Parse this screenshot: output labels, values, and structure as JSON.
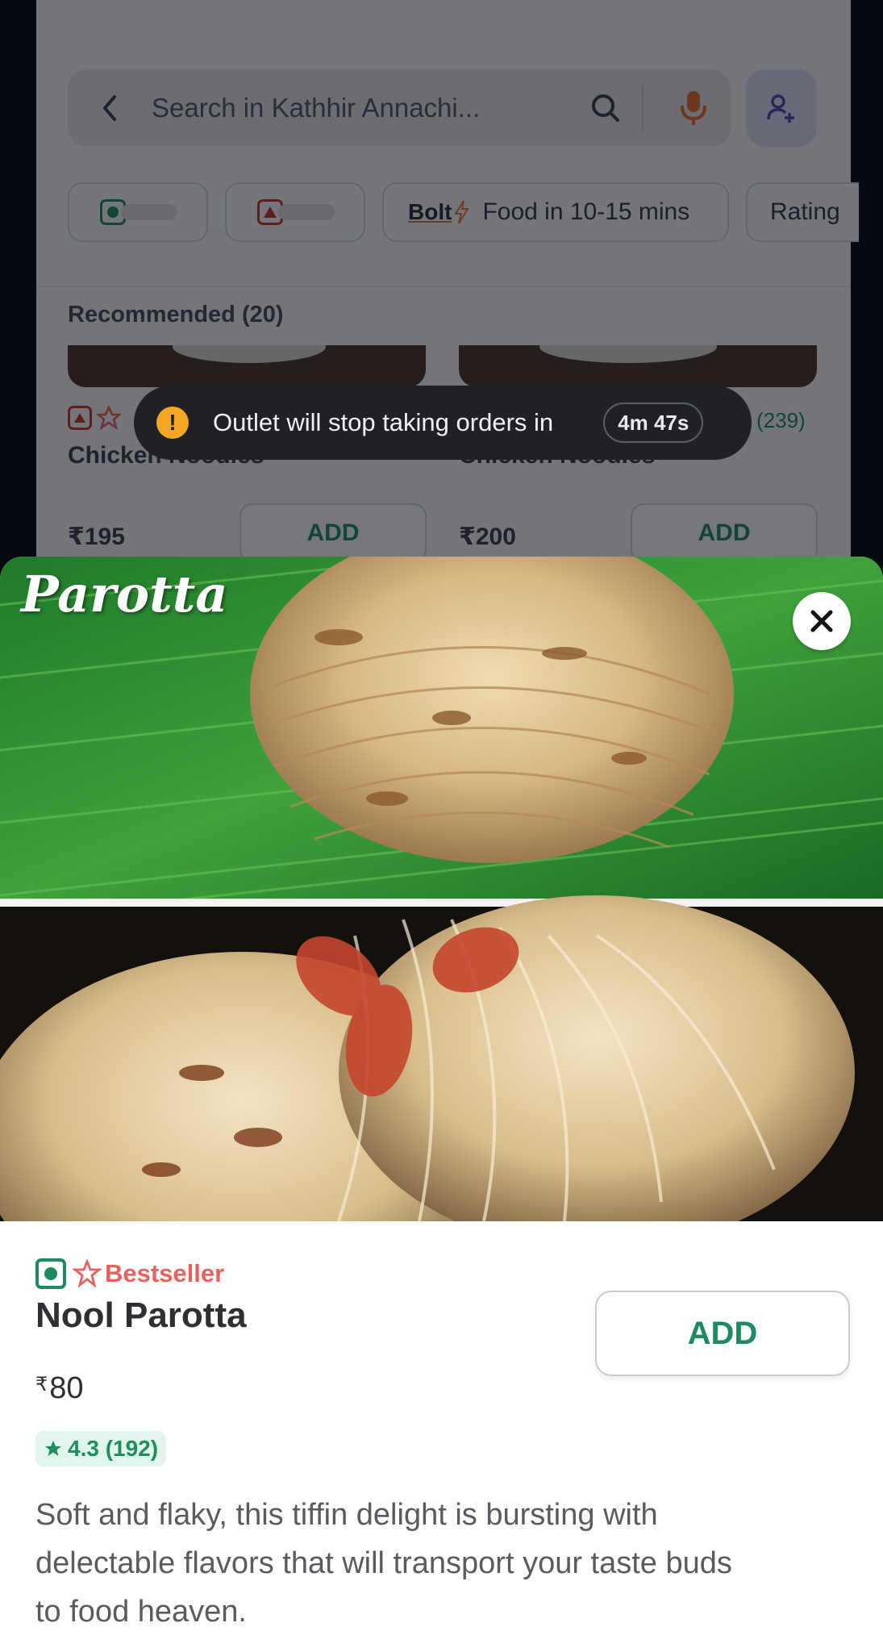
{
  "search": {
    "placeholder": "Search in Kathhir Annachi..."
  },
  "filters": {
    "bolt_label": "Bolt",
    "bolt_text": "Food in 10-15 mins",
    "rating_label": "Rating"
  },
  "section": {
    "title": "Recommended (20)"
  },
  "background_items": [
    {
      "name": "Chicken Noodles",
      "price": "₹195",
      "add_label": "ADD"
    },
    {
      "name": "Chicken Noodles",
      "price": "₹200",
      "add_label": "ADD",
      "rating_count": "(239)"
    }
  ],
  "toast": {
    "message": "Outlet will stop taking orders in",
    "timer": "4m 47s"
  },
  "item": {
    "image_caption": "Parotta",
    "badge": "Bestseller",
    "name": "Nool Parotta",
    "currency": "₹",
    "price": "80",
    "rating": "4.3 (192)",
    "add_label": "ADD",
    "description": "Soft and flaky, this tiffin delight is bursting with delectable flavors that will transport your taste buds to food heaven."
  },
  "colors": {
    "veg_green": "#1f8a5e",
    "nonveg_red": "#c4372c",
    "bestseller": "#e8615a",
    "mic_orange": "#e86a2c",
    "toast_warning": "#f5a623"
  }
}
